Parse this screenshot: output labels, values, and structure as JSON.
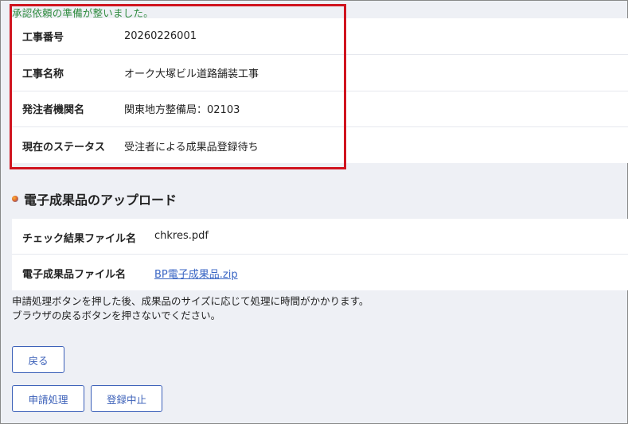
{
  "notice": "承認依頼の準備が整いました。",
  "info": {
    "rows": [
      {
        "label": "工事番号",
        "value": "20260226001"
      },
      {
        "label": "工事名称",
        "value": "オーク大塚ビル道路舗装工事"
      },
      {
        "label": "発注者機関名",
        "value": "関東地方整備局：02103"
      },
      {
        "label": "現在のステータス",
        "value": "受注者による成果品登録待ち"
      }
    ]
  },
  "upload": {
    "title": "電子成果品のアップロード",
    "check_label": "チェック結果ファイル名",
    "check_value": "chkres.pdf",
    "product_label": "電子成果品ファイル名",
    "product_value": "BP電子成果品.zip"
  },
  "notes": [
    "申請処理ボタンを押した後、成果品のサイズに応じて処理に時間がかかります。",
    "ブラウザの戻るボタンを押さないでください。"
  ],
  "buttons": {
    "back": "戻る",
    "apply": "申請処理",
    "cancel": "登録中止"
  },
  "colors": {
    "highlight": "#d0141f",
    "notice": "#2e8b3e",
    "accent": "#3a5fb8"
  }
}
